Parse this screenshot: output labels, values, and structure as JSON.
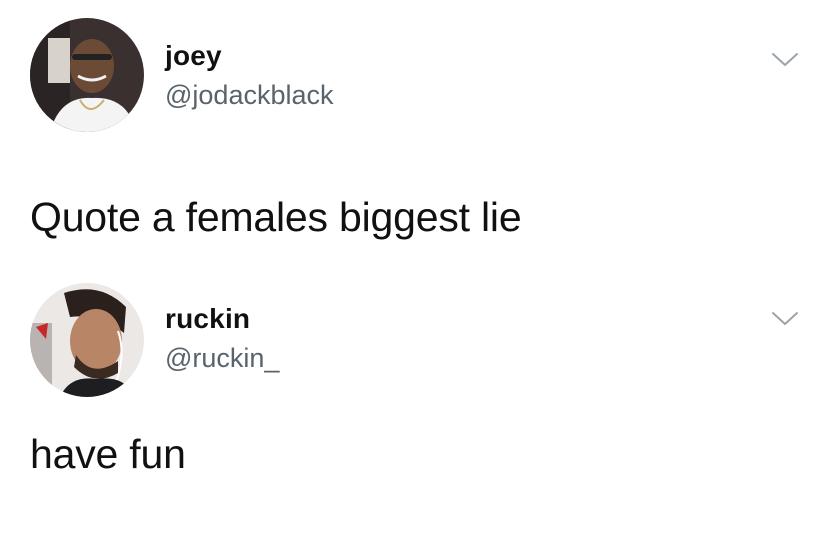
{
  "tweets": [
    {
      "display_name": "joey",
      "handle": "@jodackblack",
      "text": "Quote a females biggest lie",
      "avatar": "profile-photo",
      "menu_icon": "chevron-down-icon"
    },
    {
      "display_name": "ruckin",
      "handle": "@ruckin_",
      "text": "have fun",
      "avatar": "profile-photo",
      "menu_icon": "chevron-down-icon"
    }
  ],
  "colors": {
    "background": "#ffffff",
    "text": "#111111",
    "handle": "#59636b",
    "chevron": "#9aa4ac"
  }
}
